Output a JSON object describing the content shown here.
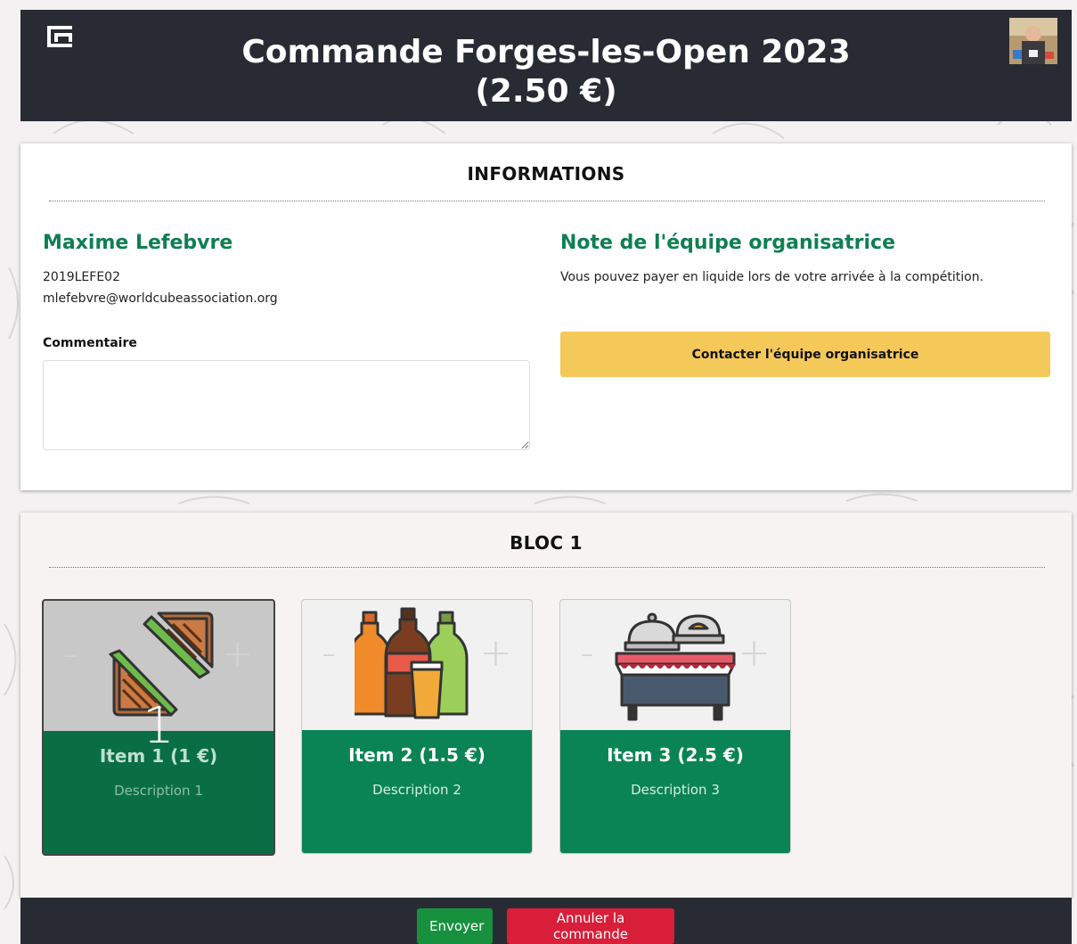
{
  "header": {
    "title_line1": "Commande Forges-les-Open 2023",
    "title_line2": "(2.50 €)",
    "logo_icon": "brand-logo-icon",
    "avatar": "user-avatar"
  },
  "info": {
    "section_title": "INFORMATIONS",
    "name": "Maxime Lefebvre",
    "wca_id": "2019LEFE02",
    "email": "mlefebvre@worldcubeassociation.org",
    "comment_label": "Commentaire",
    "comment_value": "",
    "note_title": "Note de l'équipe organisatrice",
    "note_text": "Vous pouvez payer en liquide lors de votre arrivée à la compétition.",
    "contact_button": "Contacter l'équipe organisatrice"
  },
  "bloc": {
    "title": "BLOC 1",
    "items": [
      {
        "name": "Item 1 (1 €)",
        "description": "Description 1",
        "quantity": "1",
        "minus": "-",
        "plus": "+",
        "icon": "sandwich-icon",
        "selected": true
      },
      {
        "name": "Item 2 (1.5 €)",
        "description": "Description 2",
        "quantity": "",
        "minus": "-",
        "plus": "+",
        "icon": "drinks-icon",
        "selected": false
      },
      {
        "name": "Item 3 (2.5 €)",
        "description": "Description 3",
        "quantity": "",
        "minus": "-",
        "plus": "+",
        "icon": "buffet-icon",
        "selected": false
      }
    ]
  },
  "footer": {
    "send_button": "Envoyer",
    "cancel_button": "Annuler la commande"
  },
  "colors": {
    "header_bg": "#282b33",
    "accent_green": "#0f7f52",
    "item_green": "#0a8455",
    "contact_yellow": "#f5c85a",
    "send_green": "#18913f",
    "cancel_red": "#d81e39"
  }
}
